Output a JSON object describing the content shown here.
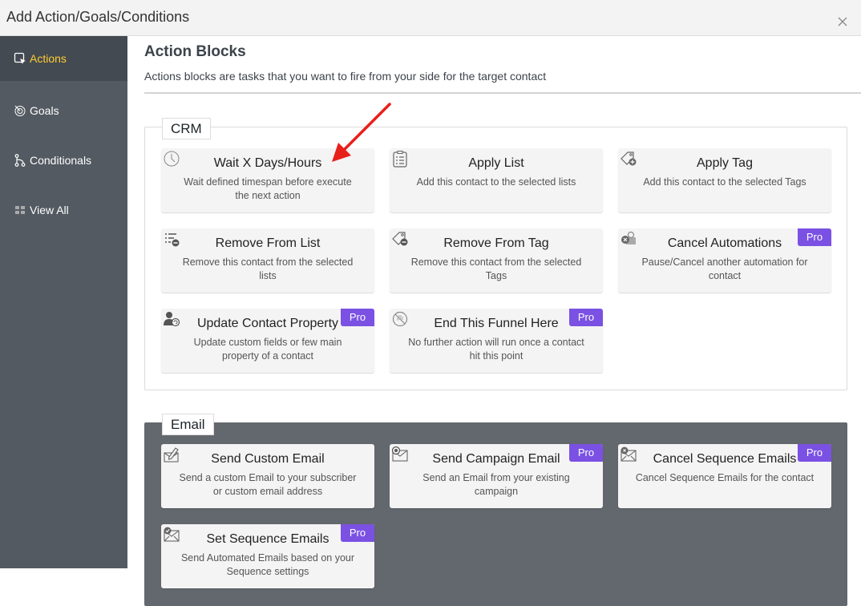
{
  "window": {
    "title": "Add Action/Goals/Conditions",
    "close_icon": "close-icon"
  },
  "sidebar": {
    "items": [
      {
        "label": "Actions",
        "icon": "pointer-box-icon",
        "active": true
      },
      {
        "label": "Goals",
        "icon": "target-icon",
        "active": false
      },
      {
        "label": "Conditionals",
        "icon": "branch-icon",
        "active": false
      },
      {
        "label": "View All",
        "icon": "grid-icon",
        "active": false
      }
    ]
  },
  "main": {
    "heading": "Action Blocks",
    "description": "Actions blocks are tasks that you want to fire from your side for the target contact"
  },
  "groups": {
    "crm": {
      "label": "CRM",
      "cards": [
        {
          "title": "Wait X Days/Hours",
          "desc": "Wait defined timespan before execute the next action",
          "icon": "clock-icon",
          "pro": false
        },
        {
          "title": "Apply List",
          "desc": "Add this contact to the selected lists",
          "icon": "clipboard-list-icon",
          "pro": false
        },
        {
          "title": "Apply Tag",
          "desc": "Add this contact to the selected Tags",
          "icon": "tag-plus-icon",
          "pro": false
        },
        {
          "title": "Remove From List",
          "desc": "Remove this contact from the selected lists",
          "icon": "list-minus-icon",
          "pro": false
        },
        {
          "title": "Remove From Tag",
          "desc": "Remove this contact from the selected Tags",
          "icon": "tag-minus-icon",
          "pro": false
        },
        {
          "title": "Cancel Automations",
          "desc": "Pause/Cancel another automation for contact",
          "icon": "cancel-automation-icon",
          "pro": true
        },
        {
          "title": "Update Contact Property",
          "desc": "Update custom fields or few main property of a contact",
          "icon": "user-edit-icon",
          "pro": true
        },
        {
          "title": "End This Funnel Here",
          "desc": "No further action will run once a contact hit this point",
          "icon": "stop-hand-icon",
          "pro": true
        }
      ]
    },
    "email": {
      "label": "Email",
      "cards": [
        {
          "title": "Send Custom Email",
          "desc": "Send a custom Email to your subscriber or custom email address",
          "icon": "envelope-pen-icon",
          "pro": false
        },
        {
          "title": "Send Campaign Email",
          "desc": "Send an Email from your existing campaign",
          "icon": "envelope-campaign-icon",
          "pro": true
        },
        {
          "title": "Cancel Sequence Emails",
          "desc": "Cancel Sequence Emails for the contact",
          "icon": "envelope-cancel-icon",
          "pro": true
        },
        {
          "title": "Set Sequence Emails",
          "desc": "Send Automated Emails based on your Sequence settings",
          "icon": "envelope-check-icon",
          "pro": true
        }
      ]
    }
  },
  "pro_badge": "Pro",
  "colors": {
    "accent_active": "#ffcc33",
    "pro_badge": "#7b51e3",
    "sidebar_bg": "#535a62",
    "annotation_arrow": "#e8201a"
  }
}
